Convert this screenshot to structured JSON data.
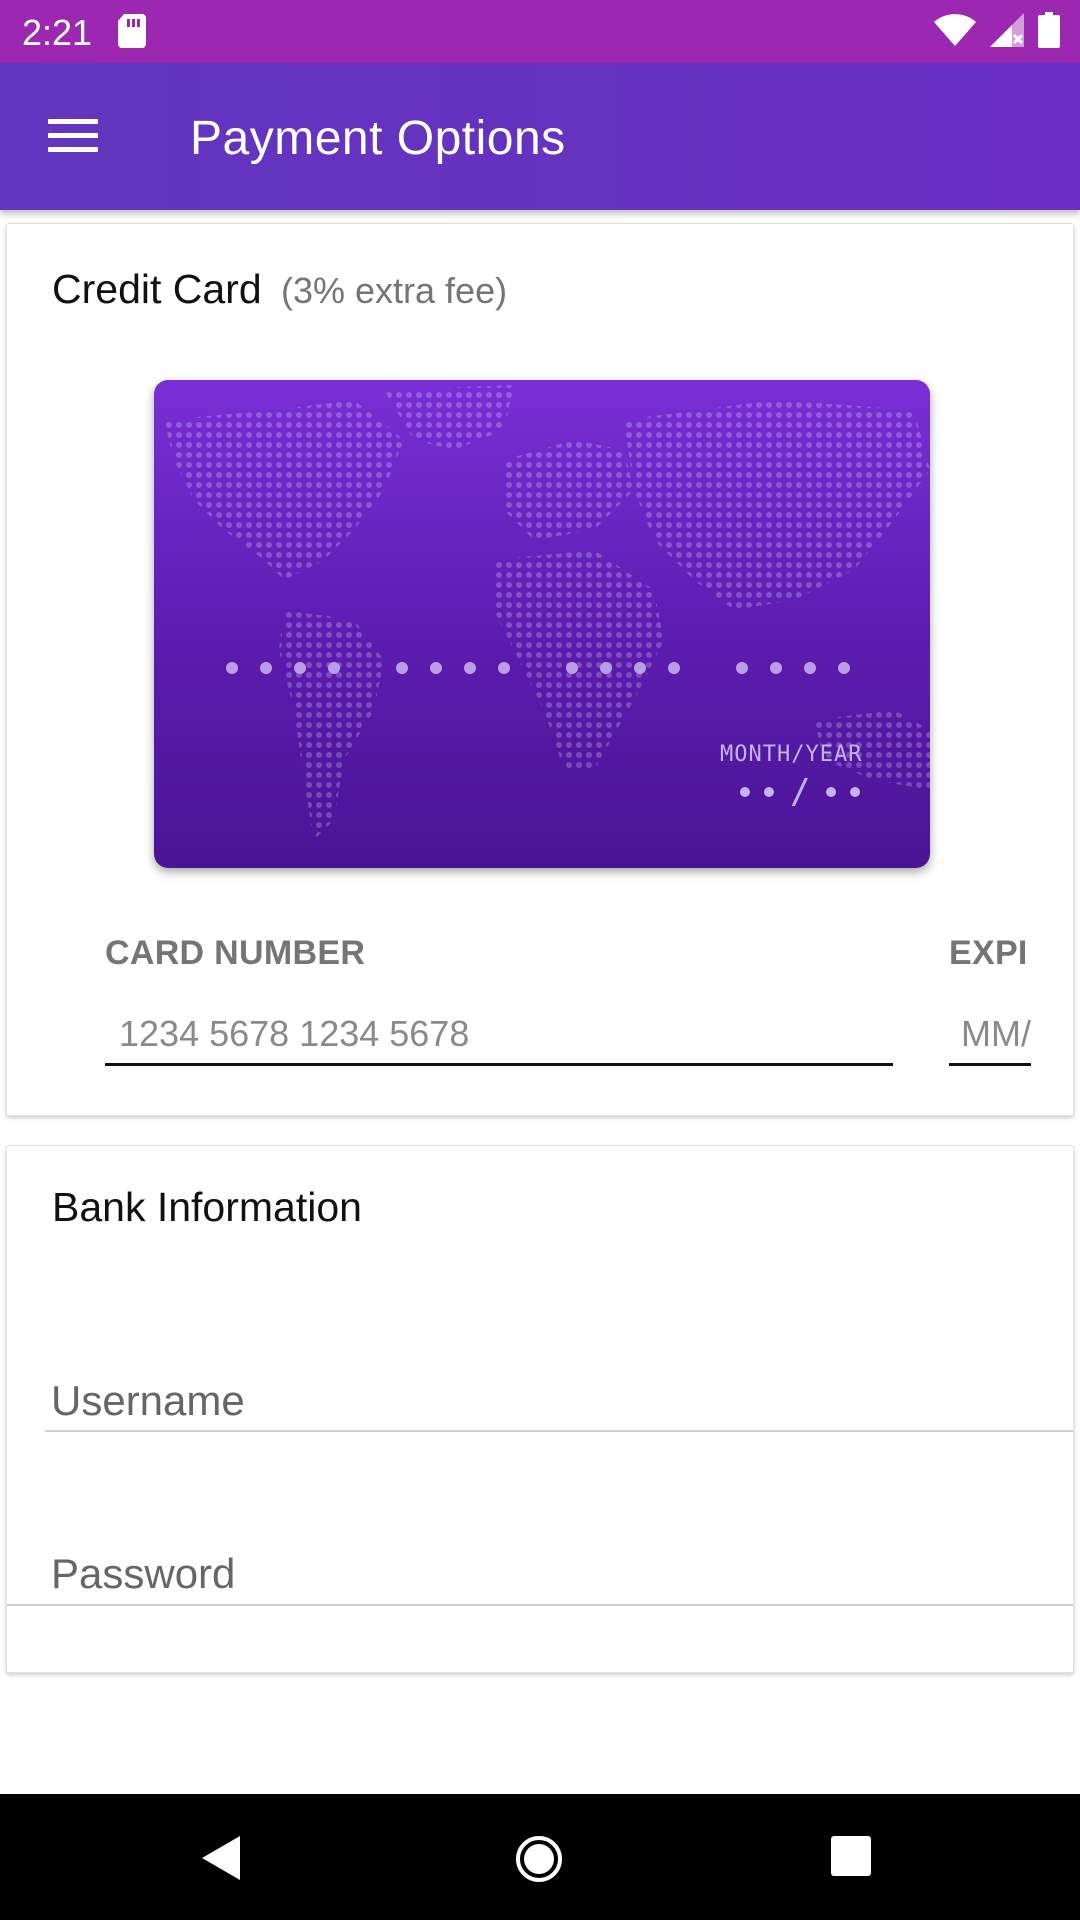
{
  "status_bar": {
    "time": "2:21",
    "icons": [
      "sd-card-icon",
      "wifi-icon",
      "signal-icon",
      "battery-icon"
    ]
  },
  "app_bar": {
    "title": "Payment Options",
    "menu_icon": "menu-icon"
  },
  "credit_card": {
    "title": "Credit Card",
    "fee_note": "(3% extra fee)",
    "card_visual": {
      "expiry_label": "MONTH/YEAR"
    },
    "card_number_label": "CARD NUMBER",
    "card_number_placeholder": "1234 5678 1234 5678",
    "card_number_value": "",
    "expiry_label": "EXPI",
    "expiry_placeholder": "MM/",
    "expiry_value": ""
  },
  "bank": {
    "title": "Bank Information",
    "username_placeholder": "Username",
    "username_value": "",
    "password_placeholder": "Password",
    "password_value": ""
  },
  "colors": {
    "status_bar": "#9c27b0",
    "app_bar": "#6a2ec2",
    "card_top": "#7a2fd6",
    "card_bottom": "#4a1496"
  },
  "nav_bar": {
    "buttons": [
      "back-icon",
      "home-icon",
      "recent-apps-icon"
    ]
  }
}
